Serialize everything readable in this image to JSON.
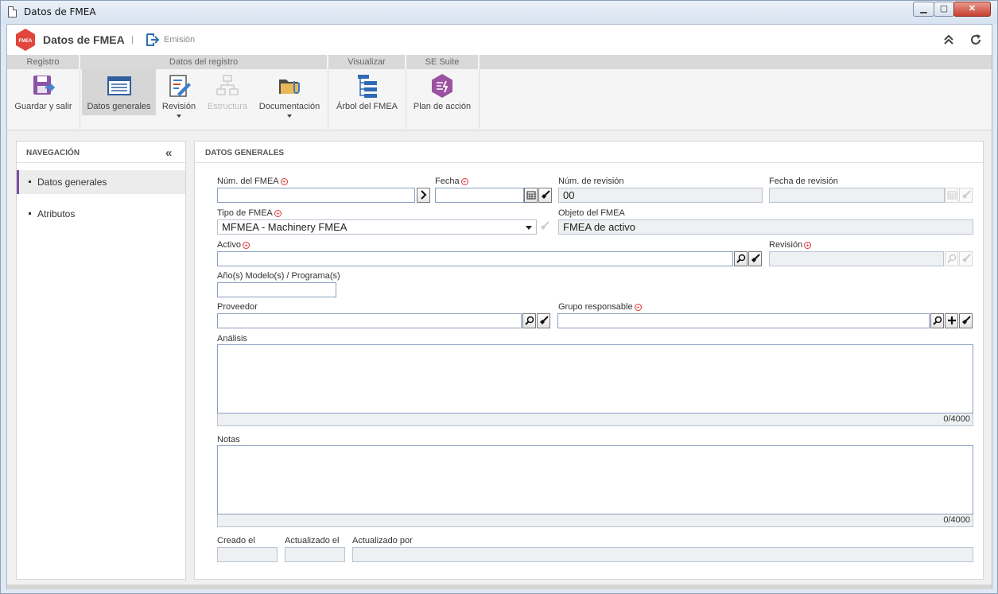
{
  "window": {
    "title": "Datos de FMEA"
  },
  "app": {
    "title": "Datos de FMEA",
    "separator": "|",
    "emision": "Emisión",
    "logo_text": "FMEA"
  },
  "ribbon": {
    "groups": [
      {
        "label": "Registro"
      },
      {
        "label": "Datos del registro"
      },
      {
        "label": "Visualizar"
      },
      {
        "label": "SE Suite"
      }
    ],
    "buttons": {
      "guardar": "Guardar y salir",
      "datos_generales": "Datos generales",
      "revision": "Revisión",
      "estructura": "Estructura",
      "documentacion": "Documentación",
      "arbol": "Árbol del FMEA",
      "plan": "Plan de acción"
    }
  },
  "nav": {
    "title": "NAVEGACIÓN",
    "items": [
      {
        "label": "Datos generales",
        "selected": true
      },
      {
        "label": "Atributos",
        "selected": false
      }
    ]
  },
  "main": {
    "title": "DATOS GENERALES",
    "fields": {
      "num_fmea": {
        "label": "Núm. del FMEA",
        "value": ""
      },
      "fecha": {
        "label": "Fecha",
        "value": ""
      },
      "num_revision": {
        "label": "Núm. de revisión",
        "value": "00"
      },
      "fecha_revision": {
        "label": "Fecha de revisión",
        "value": ""
      },
      "tipo_fmea": {
        "label": "Tipo de FMEA",
        "value": "MFMEA - Machinery FMEA"
      },
      "objeto_fmea": {
        "label": "Objeto del FMEA",
        "value": "FMEA de activo"
      },
      "activo": {
        "label": "Activo",
        "value": ""
      },
      "revision": {
        "label": "Revisión",
        "value": ""
      },
      "anos_modelo": {
        "label": "Año(s) Modelo(s) / Programa(s)",
        "value": ""
      },
      "proveedor": {
        "label": "Proveedor",
        "value": ""
      },
      "grupo_responsable": {
        "label": "Grupo responsable",
        "value": ""
      },
      "analisis": {
        "label": "Análisis",
        "value": "",
        "counter": "0/4000"
      },
      "notas": {
        "label": "Notas",
        "value": "",
        "counter": "0/4000"
      },
      "creado_el": {
        "label": "Creado el",
        "value": ""
      },
      "actualizado_el": {
        "label": "Actualizado el",
        "value": ""
      },
      "actualizado_por": {
        "label": "Actualizado por",
        "value": ""
      }
    }
  },
  "colors": {
    "accent": "#7b4fa0",
    "logo": "#e1463c",
    "required": "#d33333",
    "input_border": "#8a9fc0"
  }
}
